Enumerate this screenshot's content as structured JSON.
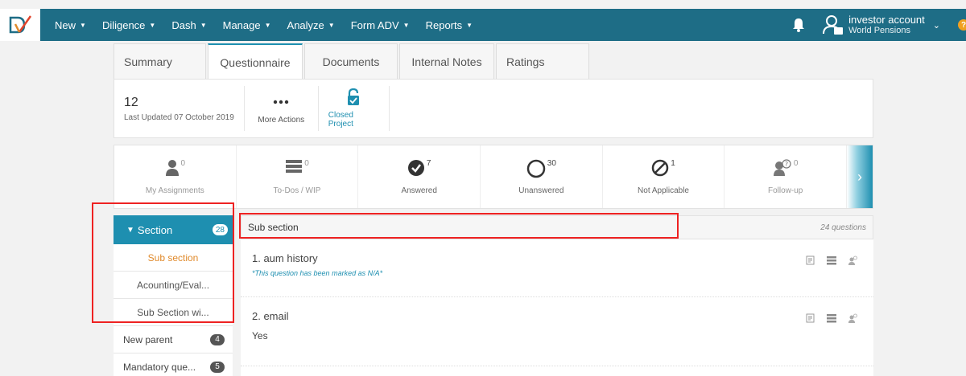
{
  "nav": {
    "items": [
      "New",
      "Diligence",
      "Dash",
      "Manage",
      "Analyze",
      "Form ADV",
      "Reports"
    ],
    "user_name": "investor account",
    "user_org": "World Pensions"
  },
  "tabs": [
    "Summary",
    "Questionnaire",
    "Documents",
    "Internal Notes",
    "Ratings"
  ],
  "info": {
    "number": "12",
    "last_updated": "Last Updated 07 October 2019",
    "more_actions": "More Actions",
    "closed_project": "Closed Project"
  },
  "stats": [
    {
      "label": "My Assignments",
      "count": "0"
    },
    {
      "label": "To-Dos / WIP",
      "count": "0"
    },
    {
      "label": "Answered",
      "count": "7"
    },
    {
      "label": "Unanswered",
      "count": "30"
    },
    {
      "label": "Not Applicable",
      "count": "1"
    },
    {
      "label": "Follow-up",
      "count": "0"
    }
  ],
  "sidebar": {
    "section_label": "Section",
    "section_count": "28",
    "subsections": [
      "Sub section",
      "Acounting/Eval...",
      "Sub Section wi..."
    ],
    "items": [
      {
        "label": "New parent",
        "count": "4"
      },
      {
        "label": "Mandatory que...",
        "count": "5"
      }
    ]
  },
  "main": {
    "section_title": "Sub section",
    "question_count": "24 questions",
    "questions": [
      {
        "title": "1. aum history",
        "note": "*This question has been marked as N/A*"
      },
      {
        "title": "2. email",
        "answer": "Yes"
      }
    ]
  },
  "colors": {
    "nav": "#1e6d86",
    "accent": "#1e8fb0",
    "active_sub": "#e08a2c",
    "highlight": "#e22222"
  }
}
